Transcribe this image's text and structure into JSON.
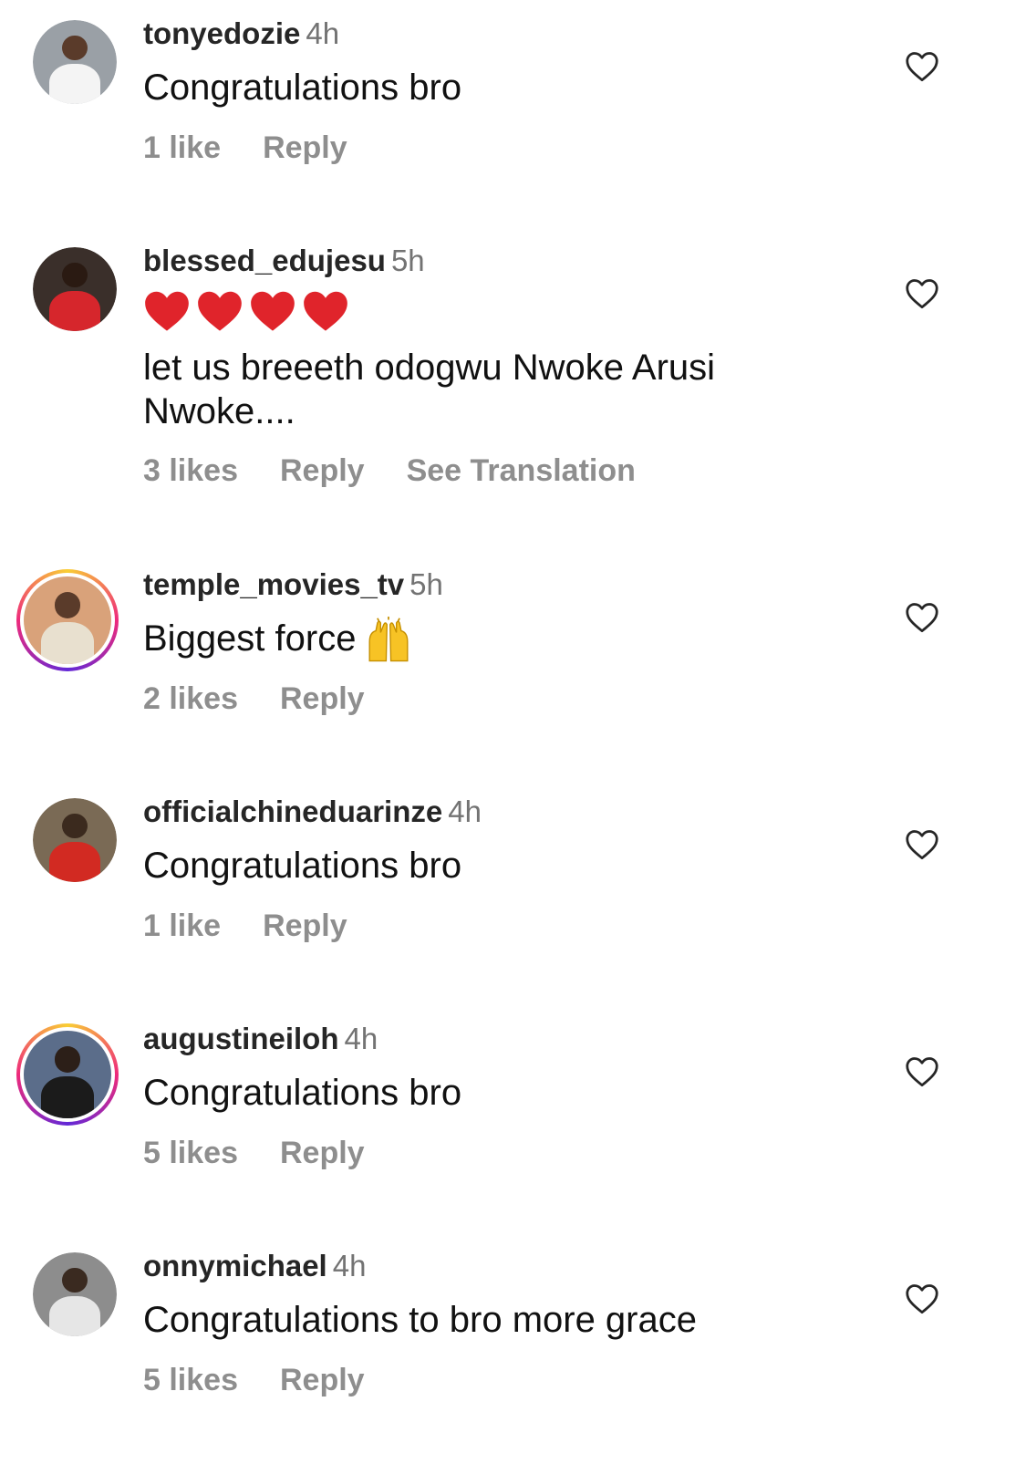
{
  "comments": [
    {
      "user": "tonyedozie",
      "time": "4h",
      "text": "Congratulations bro",
      "likes": "1 like",
      "reply": "Reply",
      "avatar_bg": "#9aa0a6",
      "ring": false
    },
    {
      "user": "blessed_edujesu",
      "time": "5h",
      "emoji": "❤️❤️❤️❤️",
      "text": "let us breeeth odogwu Nwoke Arusi Nwoke....",
      "likes": "3 likes",
      "reply": "Reply",
      "translate": "See Translation",
      "avatar_bg": "#3a2f2a",
      "ring": false
    },
    {
      "user": "temple_movies_tv",
      "time": "5h",
      "text": "Biggest force",
      "emoji_suffix": "🙌",
      "likes": "2 likes",
      "reply": "Reply",
      "avatar_bg": "#d9a27a",
      "ring": true
    },
    {
      "user": "officialchineduarinze",
      "time": "4h",
      "text": "Congratulations bro",
      "likes": "1 like",
      "reply": "Reply",
      "avatar_bg": "#7a6a55",
      "ring": false
    },
    {
      "user": "augustineiloh",
      "time": "4h",
      "text": "Congratulations bro",
      "likes": "5 likes",
      "reply": "Reply",
      "avatar_bg": "#5b6d8a",
      "ring": true
    },
    {
      "user": "onnymichael",
      "time": "4h",
      "text": "Congratulations to bro more grace",
      "likes": "5 likes",
      "reply": "Reply",
      "avatar_bg": "#8d8d8d",
      "ring": false
    }
  ],
  "colors": {
    "username": "#262626",
    "meta": "#8e8e8e",
    "heart_outline": "#262626",
    "emoji_heart": "#e0242b"
  },
  "icons": {
    "like": "heart-outline-icon",
    "emoji_heart": "red-heart-emoji",
    "raise": "raising-hands-emoji"
  }
}
